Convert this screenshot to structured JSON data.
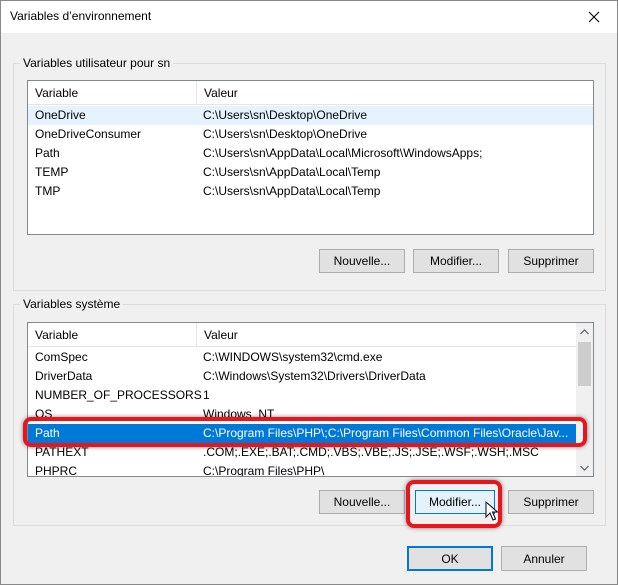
{
  "window": {
    "title": "Variables d’environnement"
  },
  "user_section": {
    "label": "Variables utilisateur pour sn",
    "columns": [
      "Variable",
      "Valeur"
    ],
    "rows": [
      {
        "name": "OneDrive",
        "value": "C:\\Users\\sn\\Desktop\\OneDrive"
      },
      {
        "name": "OneDriveConsumer",
        "value": "C:\\Users\\sn\\Desktop\\OneDrive"
      },
      {
        "name": "Path",
        "value": "C:\\Users\\sn\\AppData\\Local\\Microsoft\\WindowsApps;"
      },
      {
        "name": "TEMP",
        "value": "C:\\Users\\sn\\AppData\\Local\\Temp"
      },
      {
        "name": "TMP",
        "value": "C:\\Users\\sn\\AppData\\Local\\Temp"
      }
    ],
    "buttons": {
      "new": "Nouvelle...",
      "edit": "Modifier...",
      "delete": "Supprimer"
    }
  },
  "system_section": {
    "label": "Variables système",
    "columns": [
      "Variable",
      "Valeur"
    ],
    "rows": [
      {
        "name": "ComSpec",
        "value": "C:\\WINDOWS\\system32\\cmd.exe"
      },
      {
        "name": "DriverData",
        "value": "C:\\Windows\\System32\\Drivers\\DriverData"
      },
      {
        "name": "NUMBER_OF_PROCESSORS",
        "value": "1"
      },
      {
        "name": "OS",
        "value": "Windows_NT"
      },
      {
        "name": "Path",
        "value": "C:\\Program Files\\PHP\\;C:\\Program Files\\Common Files\\Oracle\\Jav..."
      },
      {
        "name": "PATHEXT",
        "value": ".COM;.EXE;.BAT;.CMD;.VBS;.VBE;.JS;.JSE;.WSF;.WSH;.MSC"
      },
      {
        "name": "PHPRC",
        "value": "C:\\Program Files\\PHP\\"
      }
    ],
    "selected_row": "Path",
    "buttons": {
      "new": "Nouvelle...",
      "edit": "Modifier...",
      "delete": "Supprimer"
    }
  },
  "footer": {
    "ok": "OK",
    "cancel": "Annuler"
  },
  "colors": {
    "selection": "#0078d7",
    "highlight": "#e8141e",
    "hover": "#e5f3ff"
  }
}
